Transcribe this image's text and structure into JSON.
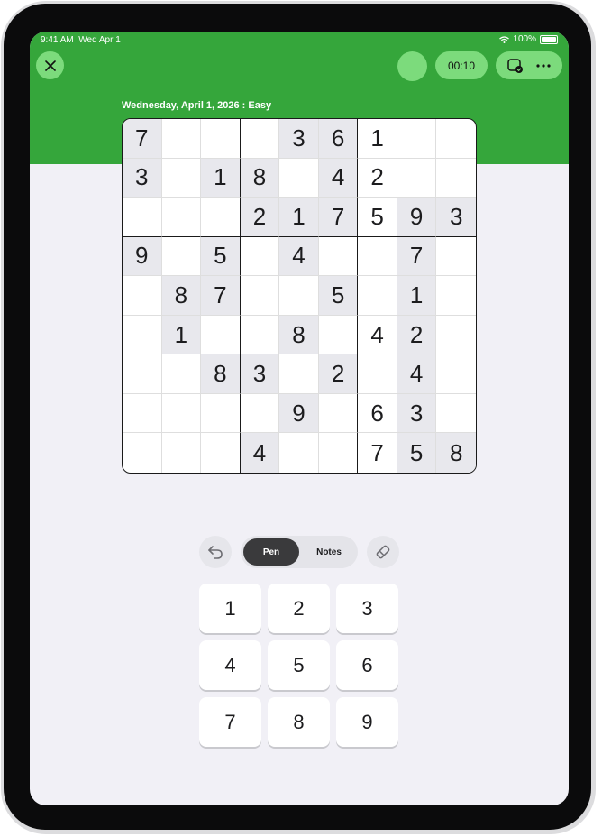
{
  "status": {
    "time": "9:41 AM",
    "date": "Wed Apr 1",
    "battery": "100%"
  },
  "header": {
    "timer": "00:10",
    "title": "Wednesday, April 1, 2026 : Easy"
  },
  "colors": {
    "header_green": "#35a63b",
    "button_green": "#7cdb7c",
    "shaded_cell": "#e8e8ed"
  },
  "board": [
    [
      "7",
      "",
      "",
      "",
      "3",
      "6",
      "1",
      "",
      ""
    ],
    [
      "3",
      "",
      "1",
      "8",
      "",
      "4",
      "2",
      "",
      ""
    ],
    [
      "",
      "",
      "",
      "2",
      "1",
      "7",
      "5",
      "9",
      "3"
    ],
    [
      "9",
      "",
      "5",
      "",
      "4",
      "",
      "",
      "7",
      ""
    ],
    [
      "",
      "8",
      "7",
      "",
      "",
      "5",
      "",
      "1",
      ""
    ],
    [
      "",
      "1",
      "",
      "",
      "8",
      "",
      "4",
      "2",
      ""
    ],
    [
      "",
      "",
      "8",
      "3",
      "",
      "2",
      "",
      "4",
      ""
    ],
    [
      "",
      "",
      "",
      "",
      "9",
      "",
      "6",
      "3",
      ""
    ],
    [
      "",
      "",
      "",
      "4",
      "",
      "",
      "7",
      "5",
      "8"
    ]
  ],
  "shaded": [
    [
      true,
      false,
      false,
      false,
      true,
      true,
      false,
      false,
      false
    ],
    [
      true,
      false,
      true,
      true,
      false,
      true,
      false,
      false,
      false
    ],
    [
      false,
      false,
      false,
      true,
      true,
      true,
      false,
      true,
      true
    ],
    [
      true,
      false,
      true,
      false,
      true,
      false,
      false,
      true,
      false
    ],
    [
      false,
      true,
      true,
      false,
      false,
      true,
      false,
      true,
      false
    ],
    [
      false,
      true,
      false,
      false,
      true,
      false,
      false,
      true,
      false
    ],
    [
      false,
      false,
      true,
      true,
      false,
      true,
      false,
      true,
      false
    ],
    [
      false,
      false,
      false,
      false,
      true,
      false,
      false,
      true,
      false
    ],
    [
      false,
      false,
      false,
      true,
      false,
      false,
      false,
      true,
      true
    ]
  ],
  "modes": {
    "pen": "Pen",
    "notes": "Notes"
  },
  "keypad": [
    "1",
    "2",
    "3",
    "4",
    "5",
    "6",
    "7",
    "8",
    "9"
  ],
  "icons": {
    "close": "close-icon",
    "undo": "undo-icon",
    "eraser": "eraser-icon",
    "actions": "check-window-icon",
    "more": "more-icon"
  }
}
